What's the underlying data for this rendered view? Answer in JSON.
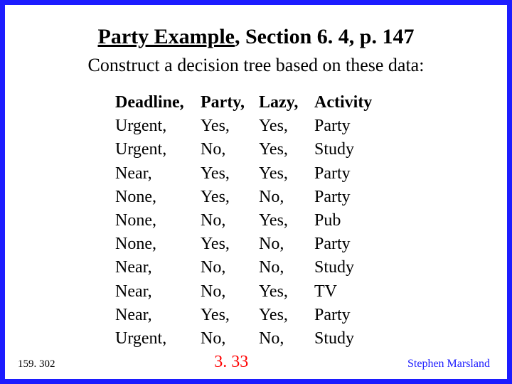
{
  "title_left": "Party Example",
  "title_right": ", Section 6. 4, p. 147",
  "subtitle": "Construct a decision tree based on these data:",
  "headers": [
    "Deadline,",
    "Party,",
    "Lazy,",
    "Activity"
  ],
  "rows": [
    [
      "Urgent,",
      "Yes,",
      "Yes,",
      "Party"
    ],
    [
      "Urgent,",
      "No,",
      "Yes,",
      "Study"
    ],
    [
      "Near,",
      "Yes,",
      "Yes,",
      "Party"
    ],
    [
      "None,",
      "Yes,",
      "No,",
      "Party"
    ],
    [
      "None,",
      "No,",
      "Yes,",
      "Pub"
    ],
    [
      "None,",
      "Yes,",
      "No,",
      "Party"
    ],
    [
      "Near,",
      "No,",
      "No,",
      "Study"
    ],
    [
      "Near,",
      "No,",
      "Yes,",
      "TV"
    ],
    [
      "Near,",
      "Yes,",
      "Yes,",
      "Party"
    ],
    [
      "Urgent,",
      "No,",
      "No,",
      "Study"
    ]
  ],
  "footer": {
    "course": "159. 302",
    "slide": "3. 33",
    "author": "Stephen Marsland"
  }
}
